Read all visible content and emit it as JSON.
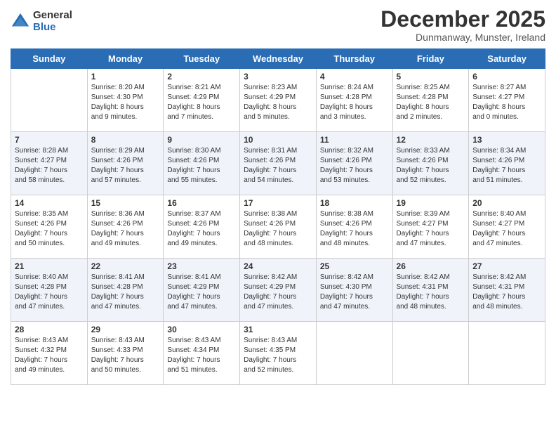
{
  "logo": {
    "general": "General",
    "blue": "Blue"
  },
  "header": {
    "month": "December 2025",
    "location": "Dunmanway, Munster, Ireland"
  },
  "weekdays": [
    "Sunday",
    "Monday",
    "Tuesday",
    "Wednesday",
    "Thursday",
    "Friday",
    "Saturday"
  ],
  "weeks": [
    [
      {
        "day": "",
        "info": ""
      },
      {
        "day": "1",
        "info": "Sunrise: 8:20 AM\nSunset: 4:30 PM\nDaylight: 8 hours\nand 9 minutes."
      },
      {
        "day": "2",
        "info": "Sunrise: 8:21 AM\nSunset: 4:29 PM\nDaylight: 8 hours\nand 7 minutes."
      },
      {
        "day": "3",
        "info": "Sunrise: 8:23 AM\nSunset: 4:29 PM\nDaylight: 8 hours\nand 5 minutes."
      },
      {
        "day": "4",
        "info": "Sunrise: 8:24 AM\nSunset: 4:28 PM\nDaylight: 8 hours\nand 3 minutes."
      },
      {
        "day": "5",
        "info": "Sunrise: 8:25 AM\nSunset: 4:28 PM\nDaylight: 8 hours\nand 2 minutes."
      },
      {
        "day": "6",
        "info": "Sunrise: 8:27 AM\nSunset: 4:27 PM\nDaylight: 8 hours\nand 0 minutes."
      }
    ],
    [
      {
        "day": "7",
        "info": "Sunrise: 8:28 AM\nSunset: 4:27 PM\nDaylight: 7 hours\nand 58 minutes."
      },
      {
        "day": "8",
        "info": "Sunrise: 8:29 AM\nSunset: 4:26 PM\nDaylight: 7 hours\nand 57 minutes."
      },
      {
        "day": "9",
        "info": "Sunrise: 8:30 AM\nSunset: 4:26 PM\nDaylight: 7 hours\nand 55 minutes."
      },
      {
        "day": "10",
        "info": "Sunrise: 8:31 AM\nSunset: 4:26 PM\nDaylight: 7 hours\nand 54 minutes."
      },
      {
        "day": "11",
        "info": "Sunrise: 8:32 AM\nSunset: 4:26 PM\nDaylight: 7 hours\nand 53 minutes."
      },
      {
        "day": "12",
        "info": "Sunrise: 8:33 AM\nSunset: 4:26 PM\nDaylight: 7 hours\nand 52 minutes."
      },
      {
        "day": "13",
        "info": "Sunrise: 8:34 AM\nSunset: 4:26 PM\nDaylight: 7 hours\nand 51 minutes."
      }
    ],
    [
      {
        "day": "14",
        "info": "Sunrise: 8:35 AM\nSunset: 4:26 PM\nDaylight: 7 hours\nand 50 minutes."
      },
      {
        "day": "15",
        "info": "Sunrise: 8:36 AM\nSunset: 4:26 PM\nDaylight: 7 hours\nand 49 minutes."
      },
      {
        "day": "16",
        "info": "Sunrise: 8:37 AM\nSunset: 4:26 PM\nDaylight: 7 hours\nand 49 minutes."
      },
      {
        "day": "17",
        "info": "Sunrise: 8:38 AM\nSunset: 4:26 PM\nDaylight: 7 hours\nand 48 minutes."
      },
      {
        "day": "18",
        "info": "Sunrise: 8:38 AM\nSunset: 4:26 PM\nDaylight: 7 hours\nand 48 minutes."
      },
      {
        "day": "19",
        "info": "Sunrise: 8:39 AM\nSunset: 4:27 PM\nDaylight: 7 hours\nand 47 minutes."
      },
      {
        "day": "20",
        "info": "Sunrise: 8:40 AM\nSunset: 4:27 PM\nDaylight: 7 hours\nand 47 minutes."
      }
    ],
    [
      {
        "day": "21",
        "info": "Sunrise: 8:40 AM\nSunset: 4:28 PM\nDaylight: 7 hours\nand 47 minutes."
      },
      {
        "day": "22",
        "info": "Sunrise: 8:41 AM\nSunset: 4:28 PM\nDaylight: 7 hours\nand 47 minutes."
      },
      {
        "day": "23",
        "info": "Sunrise: 8:41 AM\nSunset: 4:29 PM\nDaylight: 7 hours\nand 47 minutes."
      },
      {
        "day": "24",
        "info": "Sunrise: 8:42 AM\nSunset: 4:29 PM\nDaylight: 7 hours\nand 47 minutes."
      },
      {
        "day": "25",
        "info": "Sunrise: 8:42 AM\nSunset: 4:30 PM\nDaylight: 7 hours\nand 47 minutes."
      },
      {
        "day": "26",
        "info": "Sunrise: 8:42 AM\nSunset: 4:31 PM\nDaylight: 7 hours\nand 48 minutes."
      },
      {
        "day": "27",
        "info": "Sunrise: 8:42 AM\nSunset: 4:31 PM\nDaylight: 7 hours\nand 48 minutes."
      }
    ],
    [
      {
        "day": "28",
        "info": "Sunrise: 8:43 AM\nSunset: 4:32 PM\nDaylight: 7 hours\nand 49 minutes."
      },
      {
        "day": "29",
        "info": "Sunrise: 8:43 AM\nSunset: 4:33 PM\nDaylight: 7 hours\nand 50 minutes."
      },
      {
        "day": "30",
        "info": "Sunrise: 8:43 AM\nSunset: 4:34 PM\nDaylight: 7 hours\nand 51 minutes."
      },
      {
        "day": "31",
        "info": "Sunrise: 8:43 AM\nSunset: 4:35 PM\nDaylight: 7 hours\nand 52 minutes."
      },
      {
        "day": "",
        "info": ""
      },
      {
        "day": "",
        "info": ""
      },
      {
        "day": "",
        "info": ""
      }
    ]
  ]
}
